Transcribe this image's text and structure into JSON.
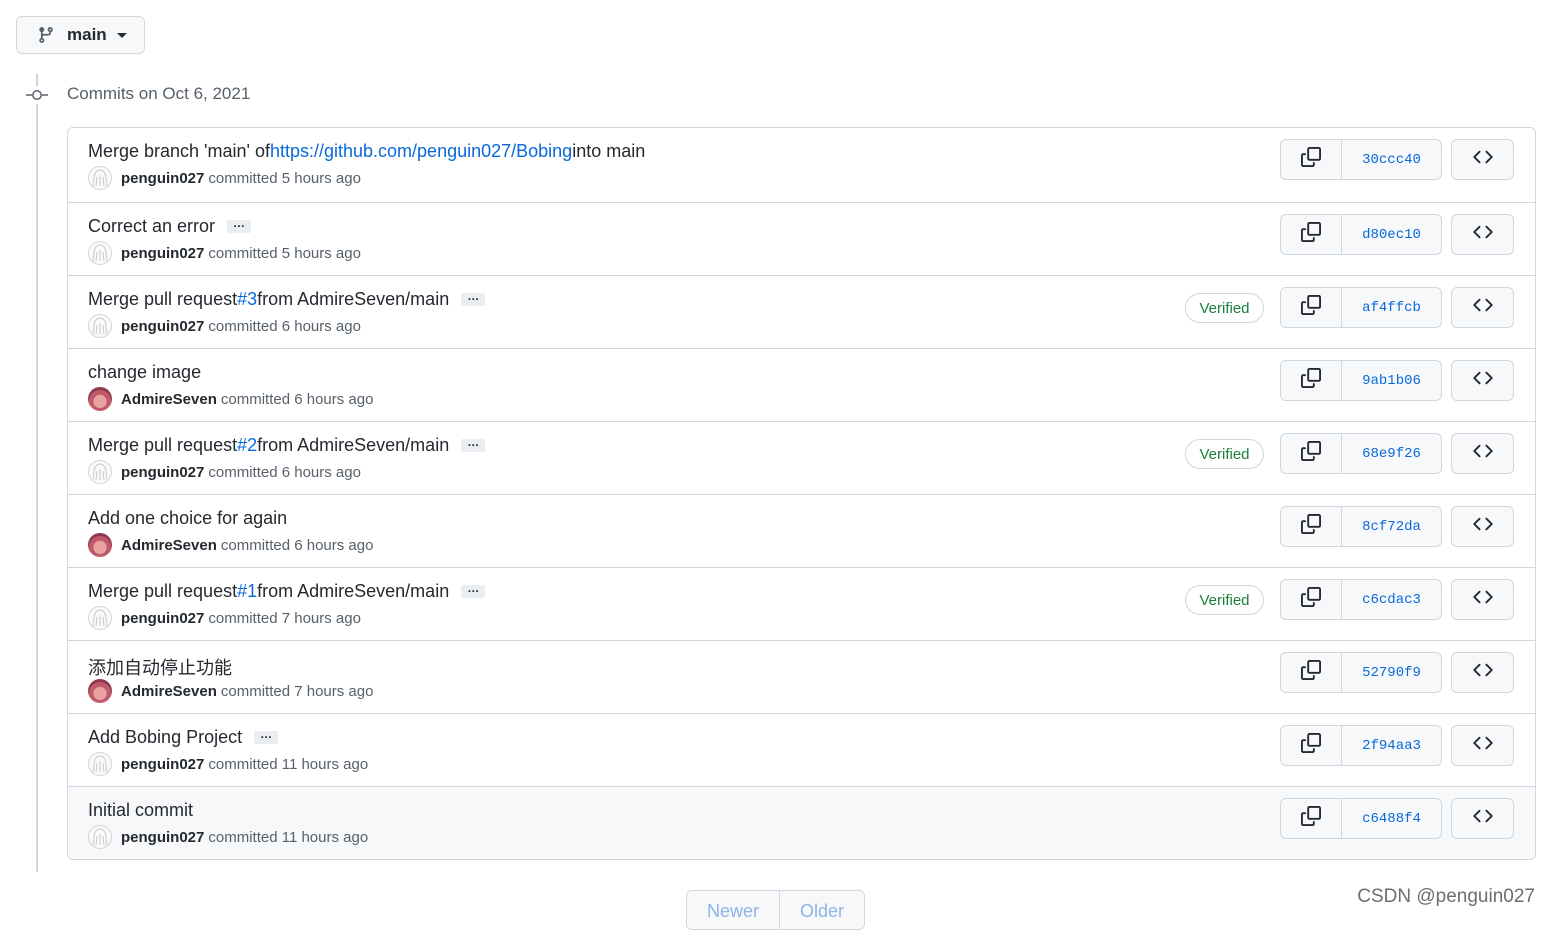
{
  "branch": {
    "name": "main"
  },
  "timeline": {
    "heading": "Commits on Oct 6, 2021"
  },
  "commits": [
    {
      "title_before": "Merge branch 'main' of ",
      "title_link": "https://github.com/penguin027/Bobing",
      "title_after": " into main",
      "has_more": false,
      "author": "penguin027",
      "avatar": "penguin",
      "action": "committed",
      "time": "5 hours ago",
      "verified": "",
      "sha": "30ccc40"
    },
    {
      "title_before": "Correct an error",
      "title_link": "",
      "title_after": "",
      "has_more": true,
      "author": "penguin027",
      "avatar": "penguin",
      "action": "committed",
      "time": "5 hours ago",
      "verified": "",
      "sha": "d80ec10"
    },
    {
      "title_before": "Merge pull request ",
      "title_link": "#3",
      "title_after": " from AdmireSeven/main",
      "has_more": true,
      "author": "penguin027",
      "avatar": "penguin",
      "action": "committed",
      "time": "6 hours ago",
      "verified": "Verified",
      "sha": "af4ffcb"
    },
    {
      "title_before": "change image",
      "title_link": "",
      "title_after": "",
      "has_more": false,
      "author": "AdmireSeven",
      "avatar": "admire",
      "action": "committed",
      "time": "6 hours ago",
      "verified": "",
      "sha": "9ab1b06"
    },
    {
      "title_before": "Merge pull request ",
      "title_link": "#2",
      "title_after": " from AdmireSeven/main",
      "has_more": true,
      "author": "penguin027",
      "avatar": "penguin",
      "action": "committed",
      "time": "6 hours ago",
      "verified": "Verified",
      "sha": "68e9f26"
    },
    {
      "title_before": "Add one choice for again",
      "title_link": "",
      "title_after": "",
      "has_more": false,
      "author": "AdmireSeven",
      "avatar": "admire",
      "action": "committed",
      "time": "6 hours ago",
      "verified": "",
      "sha": "8cf72da"
    },
    {
      "title_before": "Merge pull request ",
      "title_link": "#1",
      "title_after": " from AdmireSeven/main",
      "has_more": true,
      "author": "penguin027",
      "avatar": "penguin",
      "action": "committed",
      "time": "7 hours ago",
      "verified": "Verified",
      "sha": "c6cdac3"
    },
    {
      "title_before": "添加自动停止功能",
      "title_link": "",
      "title_after": "",
      "has_more": false,
      "author": "AdmireSeven",
      "avatar": "admire",
      "action": "committed",
      "time": "7 hours ago",
      "verified": "",
      "sha": "52790f9"
    },
    {
      "title_before": "Add Bobing Project",
      "title_link": "",
      "title_after": "",
      "has_more": true,
      "author": "penguin027",
      "avatar": "penguin",
      "action": "committed",
      "time": "11 hours ago",
      "verified": "",
      "sha": "2f94aa3"
    },
    {
      "title_before": "Initial commit",
      "title_link": "",
      "title_after": "",
      "has_more": false,
      "author": "penguin027",
      "avatar": "penguin",
      "action": "committed",
      "time": "11 hours ago",
      "verified": "",
      "sha": "c6488f4"
    }
  ],
  "ellipsis_label": "…",
  "pagination": {
    "newer": "Newer",
    "older": "Older"
  },
  "watermark": "CSDN @penguin027",
  "icons": {
    "branch": "git-branch-icon",
    "commit": "git-commit-icon",
    "copy": "copy-icon",
    "browse": "code-icon",
    "caret": "caret-down-icon"
  },
  "colors": {
    "link": "#0969da",
    "verified": "#1a7f37",
    "border": "#d0d7de",
    "text": "#24292f",
    "muted": "#57606a"
  }
}
